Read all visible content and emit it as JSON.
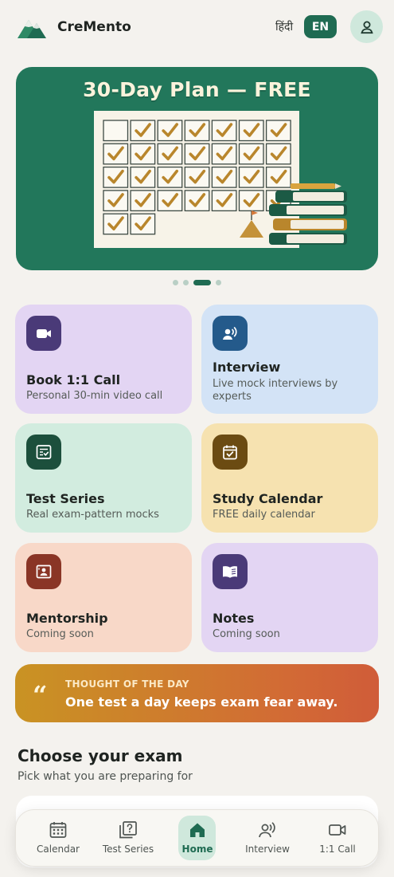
{
  "header": {
    "brand": "CreMento",
    "lang_hindi": "हिंदी",
    "lang_en": "EN"
  },
  "banner": {
    "title": "30-Day Plan — FREE",
    "checked_days": 29,
    "total_days": 30
  },
  "carousel": {
    "count": 4,
    "active_index": 2
  },
  "features": [
    {
      "title": "Book 1:1 Call",
      "subtitle": "Personal 30-min video call",
      "icon": "video-camera-icon",
      "bg": "#e3d5f3",
      "icon_bg": "#4a3a78"
    },
    {
      "title": "Interview",
      "subtitle": "Live mock interviews by experts",
      "icon": "interview-speaker-icon",
      "bg": "#d3e3f6",
      "icon_bg": "#245a8b"
    },
    {
      "title": "Test Series",
      "subtitle": "Real exam-pattern mocks",
      "icon": "test-sheet-icon",
      "bg": "#d2ecdf",
      "icon_bg": "#1c4f3c"
    },
    {
      "title": "Study Calendar",
      "subtitle": "FREE daily calendar",
      "icon": "calendar-check-icon",
      "bg": "#f6e2b0",
      "icon_bg": "#6b4b12"
    },
    {
      "title": "Mentorship",
      "subtitle": "Coming soon",
      "icon": "mentor-board-icon",
      "bg": "#f8d8c8",
      "icon_bg": "#8a3526"
    },
    {
      "title": "Notes",
      "subtitle": "Coming soon",
      "icon": "open-book-icon",
      "bg": "#e3d5f3",
      "icon_bg": "#4a3a78"
    }
  ],
  "thought": {
    "label": "THOUGHT OF THE DAY",
    "text": "One test a day keeps exam fear away."
  },
  "exam_section": {
    "title": "Choose your exam",
    "subtitle": "Pick what you are preparing for"
  },
  "bottom_nav": [
    {
      "label": "Calendar",
      "icon": "calendar-icon"
    },
    {
      "label": "Test Series",
      "icon": "quiz-icon"
    },
    {
      "label": "Home",
      "icon": "home-icon",
      "active": true
    },
    {
      "label": "Interview",
      "icon": "interview-icon"
    },
    {
      "label": "1:1 Call",
      "icon": "video-call-icon"
    }
  ],
  "colors": {
    "brand_green": "#1f6b52",
    "banner_green": "#22775b",
    "background": "#f4f2ee"
  }
}
